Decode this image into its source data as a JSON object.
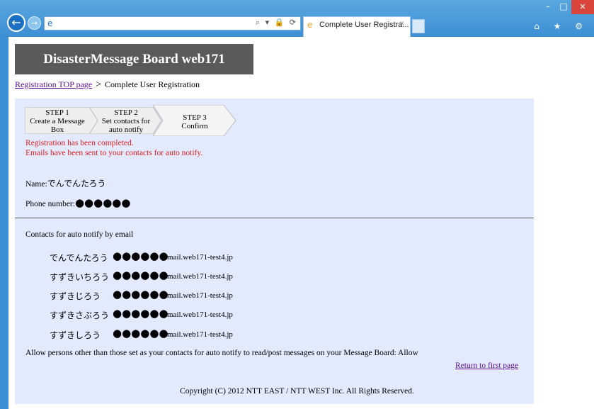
{
  "browser": {
    "tab_title": "Complete User Registra...",
    "tab_close_glyph": "×",
    "window_min": "–",
    "window_max": "□",
    "window_close": "×",
    "back_glyph": "←",
    "forward_glyph": "→",
    "address_tools": "⌕ ▾ 🔒 ⟳",
    "right_icons": "⌂ ★ ⚙"
  },
  "header": {
    "banner_title": "DisasterMessage Board web171"
  },
  "breadcrumb": {
    "link": "Registration TOP page",
    "separator": ">",
    "current": "Complete User Registration"
  },
  "steps": [
    {
      "line1": "STEP 1",
      "line2": "Create a Message",
      "line3": "Box"
    },
    {
      "line1": "STEP 2",
      "line2": "Set contacts for",
      "line3": "auto notify"
    },
    {
      "line1": "STEP 3",
      "line2": "Confirm",
      "line3": ""
    }
  ],
  "messages": {
    "completed": "Registration has been completed.",
    "emails_sent": "Emails have been sent to your contacts for auto notify."
  },
  "profile": {
    "name_label": "Name:",
    "name_value": "でんでんたろう",
    "phone_label": "Phone number:",
    "phone_value": "●●●●●●"
  },
  "contacts": {
    "title": "Contacts for auto notify by email",
    "items": [
      {
        "name": "でんでんたろう",
        "masked": "●●●●●●",
        "domain": "mail.web171-test4.jp"
      },
      {
        "name": "すずきいちろう",
        "masked": "●●●●●●",
        "domain": "mail.web171-test4.jp"
      },
      {
        "name": "すずきじろう",
        "masked": "●●●●●●",
        "domain": "mail.web171-test4.jp"
      },
      {
        "name": "すずきさぶろう",
        "masked": "●●●●●●",
        "domain": "mail.web171-test4.jp"
      },
      {
        "name": "すずきしろう",
        "masked": "●●●●●●",
        "domain": "mail.web171-test4.jp"
      }
    ]
  },
  "allow_text": "Allow persons other than those set as your contacts for auto notify to read/post messages on your Message Board: Allow",
  "return_link": "Return to first page",
  "copyright": "Copyright (C) 2012 NTT EAST / NTT WEST Inc. All Rights Reserved.",
  "colors": {
    "panel": "#e3e9ff",
    "banner": "#5a5a5a",
    "alert": "#e0201a",
    "link": "#5a0f9c",
    "chrome": "#3d8fd4"
  }
}
